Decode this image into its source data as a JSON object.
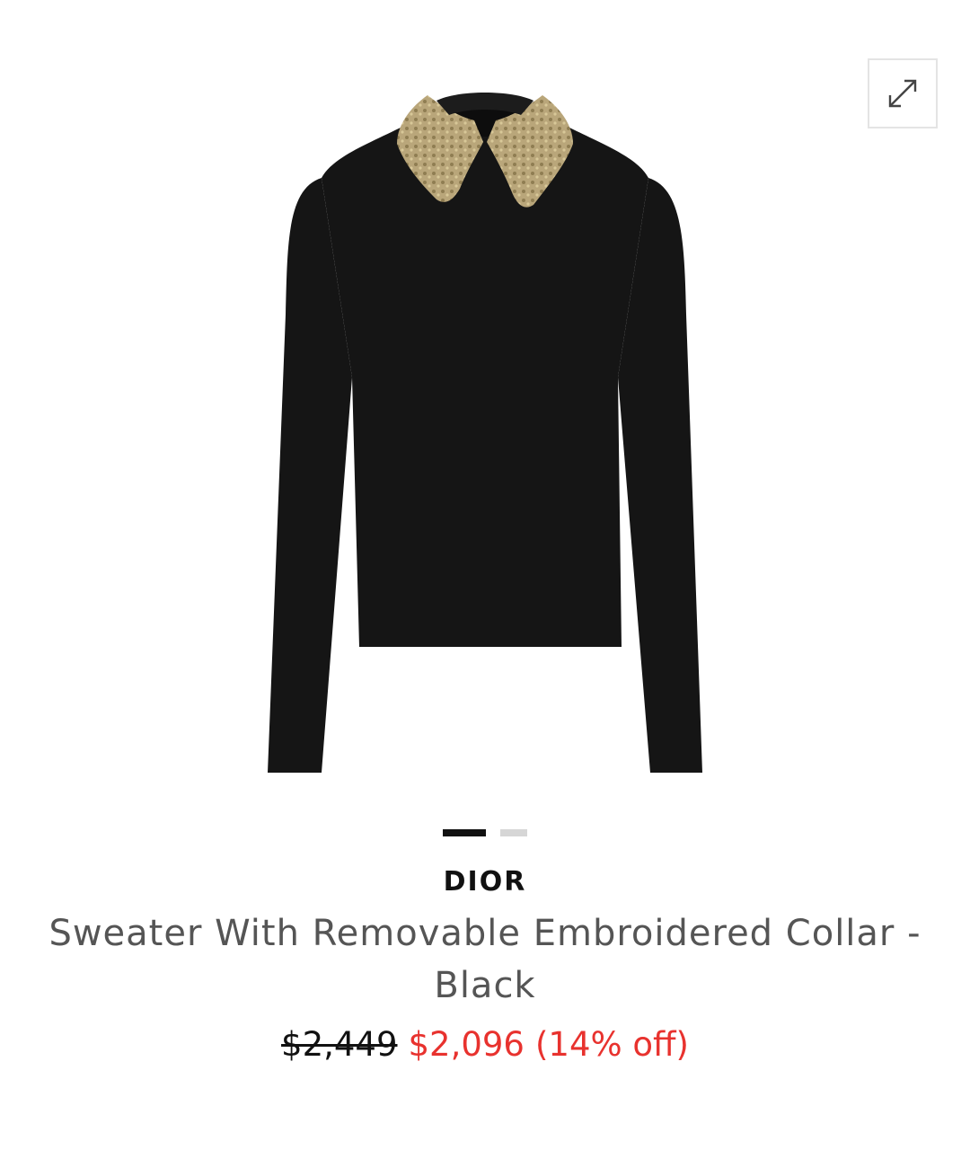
{
  "product": {
    "brand": "DIOR",
    "title_line1": "Sweater With Removable Embroidered Collar -",
    "title_line2": "Black",
    "price_original": "$2,449",
    "price_sale": "$2,096",
    "price_discount": "(14% off)",
    "image_icon": "black-sweater-gold-collar-image"
  },
  "gallery": {
    "expand_icon": "expand-icon",
    "pages": [
      {
        "active": true
      },
      {
        "active": false
      }
    ]
  },
  "colors": {
    "sale": "#e8322e",
    "sweater": "#151515",
    "collar": "#b9a67a"
  }
}
